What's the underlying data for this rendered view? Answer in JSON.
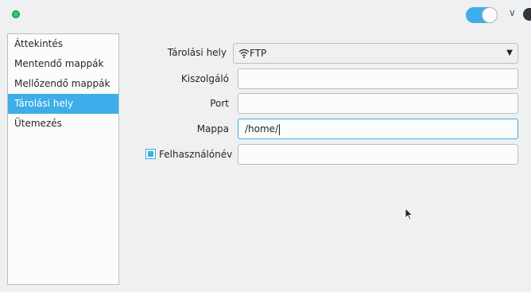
{
  "titlebar": {
    "toggle_on": true
  },
  "sidebar": {
    "items": [
      {
        "label": "Áttekintés",
        "active": false
      },
      {
        "label": "Mentendő mappák",
        "active": false
      },
      {
        "label": "Mellőzendő mappák",
        "active": false
      },
      {
        "label": "Tárolási hely",
        "active": true
      },
      {
        "label": "Ütemezés",
        "active": false
      }
    ]
  },
  "form": {
    "storage": {
      "label": "Tárolási hely",
      "value": "FTP",
      "icon": "wifi-icon"
    },
    "server": {
      "label": "Kiszolgáló",
      "value": ""
    },
    "port": {
      "label": "Port",
      "value": ""
    },
    "folder": {
      "label": "Mappa",
      "value": "/home/"
    },
    "username": {
      "label": "Felhasználónév",
      "value": "",
      "checked": true
    }
  },
  "colors": {
    "accent": "#3daee9",
    "status": "#2ecc71"
  }
}
